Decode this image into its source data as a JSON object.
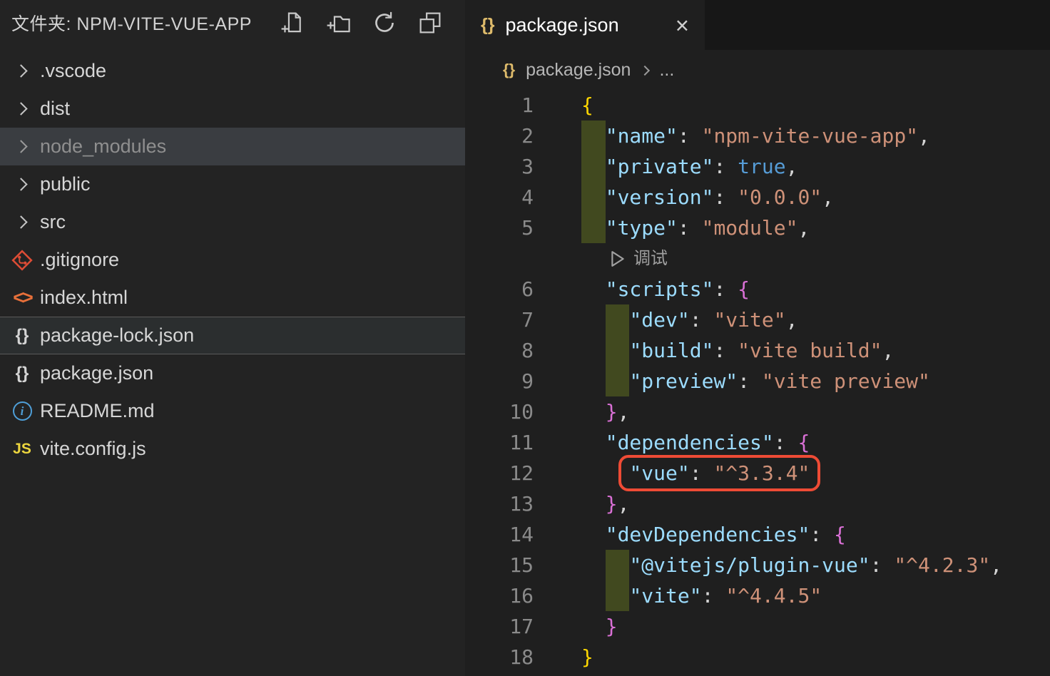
{
  "sidebar": {
    "header": {
      "title": "文件夹: NPM-VITE-VUE-APP",
      "actions": [
        "new-file-icon",
        "new-folder-icon",
        "refresh-icon",
        "collapse-folders-icon"
      ]
    },
    "items": [
      {
        "label": ".vscode",
        "kind": "folder",
        "icon": "chevron-right-icon",
        "state": ""
      },
      {
        "label": "dist",
        "kind": "folder",
        "icon": "chevron-right-icon",
        "state": ""
      },
      {
        "label": "node_modules",
        "kind": "folder",
        "icon": "chevron-right-icon",
        "state": "dimmed"
      },
      {
        "label": "public",
        "kind": "folder",
        "icon": "chevron-right-icon",
        "state": ""
      },
      {
        "label": "src",
        "kind": "folder",
        "icon": "chevron-right-icon",
        "state": ""
      },
      {
        "label": ".gitignore",
        "kind": "file",
        "icon": "git-icon",
        "state": ""
      },
      {
        "label": "index.html",
        "kind": "file",
        "icon": "html-icon",
        "state": ""
      },
      {
        "label": "package-lock.json",
        "kind": "file",
        "icon": "braces-icon",
        "state": "selected"
      },
      {
        "label": "package.json",
        "kind": "file",
        "icon": "braces-icon",
        "state": ""
      },
      {
        "label": "README.md",
        "kind": "file",
        "icon": "info-icon",
        "state": ""
      },
      {
        "label": "vite.config.js",
        "kind": "file",
        "icon": "js-icon",
        "state": ""
      }
    ]
  },
  "editor": {
    "tab": {
      "label": "package.json",
      "icon": "json-braces-icon",
      "close": "×"
    },
    "breadcrumb": {
      "icon": "json-braces-icon",
      "file": "package.json",
      "ellipsis": "..."
    },
    "codelens": {
      "label": "调试",
      "icon": "play-icon"
    },
    "lines": [
      {
        "n": 1,
        "tokens": [
          {
            "t": "{",
            "c": "b1"
          }
        ]
      },
      {
        "n": 2,
        "bar": 0,
        "tokens": [
          {
            "t": "  ",
            "c": "ws"
          },
          {
            "t": "\"name\"",
            "c": "key"
          },
          {
            "t": ": ",
            "c": "pun"
          },
          {
            "t": "\"npm-vite-vue-app\"",
            "c": "str"
          },
          {
            "t": ",",
            "c": "pun"
          }
        ]
      },
      {
        "n": 3,
        "bar": 0,
        "tokens": [
          {
            "t": "  ",
            "c": "ws"
          },
          {
            "t": "\"private\"",
            "c": "key"
          },
          {
            "t": ": ",
            "c": "pun"
          },
          {
            "t": "true",
            "c": "kw"
          },
          {
            "t": ",",
            "c": "pun"
          }
        ]
      },
      {
        "n": 4,
        "bar": 0,
        "tokens": [
          {
            "t": "  ",
            "c": "ws"
          },
          {
            "t": "\"version\"",
            "c": "key"
          },
          {
            "t": ": ",
            "c": "pun"
          },
          {
            "t": "\"0.0.0\"",
            "c": "str"
          },
          {
            "t": ",",
            "c": "pun"
          }
        ]
      },
      {
        "n": 5,
        "bar": 0,
        "tokens": [
          {
            "t": "  ",
            "c": "ws"
          },
          {
            "t": "\"type\"",
            "c": "key"
          },
          {
            "t": ": ",
            "c": "pun"
          },
          {
            "t": "\"module\"",
            "c": "str"
          },
          {
            "t": ",",
            "c": "pun"
          }
        ]
      },
      {
        "type": "lens"
      },
      {
        "n": 6,
        "tokens": [
          {
            "t": "  ",
            "c": "ws"
          },
          {
            "t": "\"scripts\"",
            "c": "key"
          },
          {
            "t": ": ",
            "c": "pun"
          },
          {
            "t": "{",
            "c": "b2"
          }
        ]
      },
      {
        "n": 7,
        "bar": 2,
        "tokens": [
          {
            "t": "    ",
            "c": "ws"
          },
          {
            "t": "\"dev\"",
            "c": "key"
          },
          {
            "t": ": ",
            "c": "pun"
          },
          {
            "t": "\"vite\"",
            "c": "str"
          },
          {
            "t": ",",
            "c": "pun"
          }
        ]
      },
      {
        "n": 8,
        "bar": 2,
        "tokens": [
          {
            "t": "    ",
            "c": "ws"
          },
          {
            "t": "\"build\"",
            "c": "key"
          },
          {
            "t": ": ",
            "c": "pun"
          },
          {
            "t": "\"vite build\"",
            "c": "str"
          },
          {
            "t": ",",
            "c": "pun"
          }
        ]
      },
      {
        "n": 9,
        "bar": 2,
        "tokens": [
          {
            "t": "    ",
            "c": "ws"
          },
          {
            "t": "\"preview\"",
            "c": "key"
          },
          {
            "t": ": ",
            "c": "pun"
          },
          {
            "t": "\"vite preview\"",
            "c": "str"
          }
        ]
      },
      {
        "n": 10,
        "tokens": [
          {
            "t": "  ",
            "c": "ws"
          },
          {
            "t": "}",
            "c": "b2"
          },
          {
            "t": ",",
            "c": "pun"
          }
        ]
      },
      {
        "n": 11,
        "tokens": [
          {
            "t": "  ",
            "c": "ws"
          },
          {
            "t": "\"dependencies\"",
            "c": "key"
          },
          {
            "t": ": ",
            "c": "pun"
          },
          {
            "t": "{",
            "c": "b2"
          }
        ]
      },
      {
        "n": 12,
        "box": 1,
        "tokens": [
          {
            "t": "    ",
            "c": "ws"
          },
          {
            "t": "\"vue\"",
            "c": "key"
          },
          {
            "t": ": ",
            "c": "pun"
          },
          {
            "t": "\"^3.3.4\"",
            "c": "str"
          }
        ]
      },
      {
        "n": 13,
        "tokens": [
          {
            "t": "  ",
            "c": "ws"
          },
          {
            "t": "}",
            "c": "b2"
          },
          {
            "t": ",",
            "c": "pun"
          }
        ]
      },
      {
        "n": 14,
        "tokens": [
          {
            "t": "  ",
            "c": "ws"
          },
          {
            "t": "\"devDependencies\"",
            "c": "key"
          },
          {
            "t": ": ",
            "c": "pun"
          },
          {
            "t": "{",
            "c": "b2"
          }
        ]
      },
      {
        "n": 15,
        "bar": 2,
        "tokens": [
          {
            "t": "    ",
            "c": "ws"
          },
          {
            "t": "\"@vitejs/plugin-vue\"",
            "c": "key"
          },
          {
            "t": ": ",
            "c": "pun"
          },
          {
            "t": "\"^4.2.3\"",
            "c": "str"
          },
          {
            "t": ",",
            "c": "pun"
          }
        ]
      },
      {
        "n": 16,
        "bar": 2,
        "tokens": [
          {
            "t": "    ",
            "c": "ws"
          },
          {
            "t": "\"vite\"",
            "c": "key"
          },
          {
            "t": ": ",
            "c": "pun"
          },
          {
            "t": "\"^4.4.5\"",
            "c": "str"
          }
        ]
      },
      {
        "n": 17,
        "tokens": [
          {
            "t": "  ",
            "c": "ws"
          },
          {
            "t": "}",
            "c": "b2"
          }
        ]
      },
      {
        "n": 18,
        "tokens": [
          {
            "t": "}",
            "c": "b1"
          }
        ]
      }
    ]
  },
  "icons": {
    "braces_glyph": "{}",
    "html_glyph": "<>",
    "js_glyph": "JS",
    "info_glyph": "i",
    "close_glyph": "×"
  },
  "colors": {
    "annotation_red": "#ee4b35",
    "git_added_gutter": "#41491f",
    "key_blue": "#9cdcfe",
    "string_orange": "#ce9178",
    "keyword_blue": "#569cd6",
    "bracket_gold": "#ffd700",
    "bracket_purple": "#da70d6",
    "tab_icon_gold": "#debb6b"
  }
}
